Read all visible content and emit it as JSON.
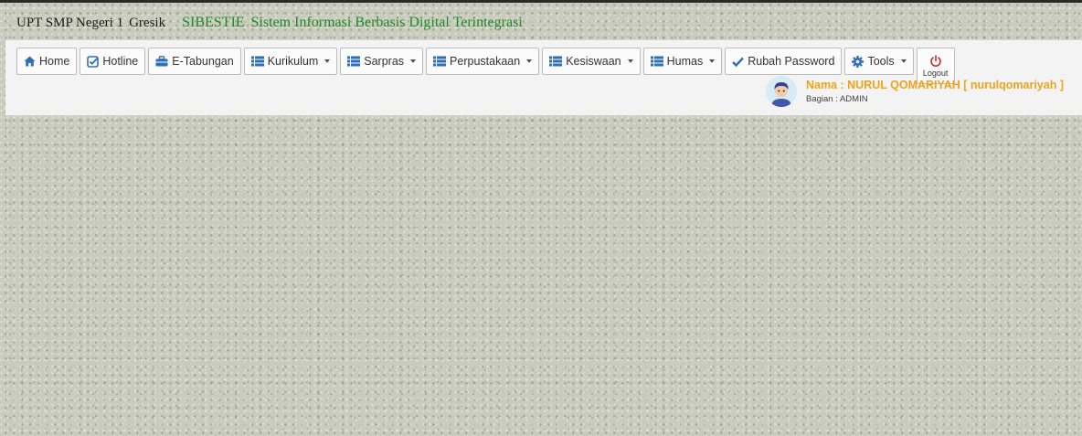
{
  "header": {
    "school": "UPT SMP Negeri 1",
    "city": "Gresik",
    "app_short": "SIBESTIE",
    "app_full": "Sistem Informasi Berbasis Digital Terintegrasi"
  },
  "nav": {
    "home": "Home",
    "hotline": "Hotline",
    "etabungan": "E-Tabungan",
    "kurikulum": "Kurikulum",
    "sarpras": "Sarpras",
    "perpustakaan": "Perpustakaan",
    "kesiswaan": "Kesiswaan",
    "humas": "Humas",
    "rubah_password": "Rubah Password",
    "tools": "Tools",
    "logout": "Logout"
  },
  "user": {
    "name": "Nama : NURUL QOMARIYAH [ nurulqomariyah ]",
    "role": "Bagian : ADMIN"
  },
  "colors": {
    "brand_green": "#1f8a2b",
    "icon_blue": "#2f6fb5",
    "user_orange": "#f0a21a",
    "logout_red": "#c9302c"
  }
}
